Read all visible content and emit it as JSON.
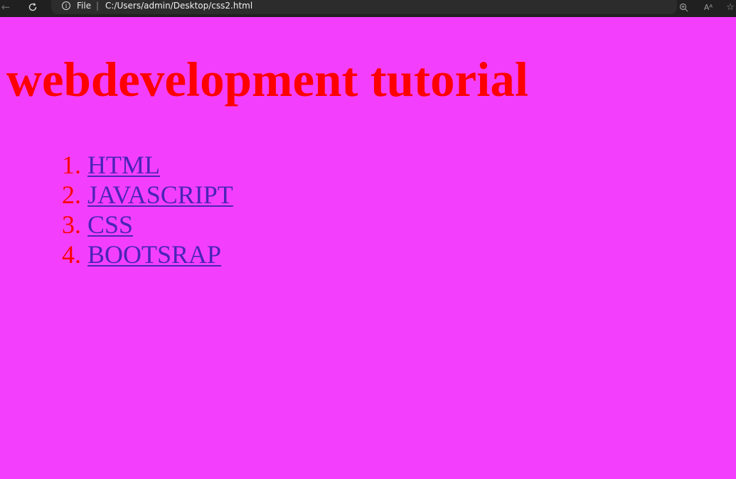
{
  "browser": {
    "back_icon": "arrow-left-icon",
    "reload_icon": "reload-icon",
    "info_icon": "info-icon",
    "scheme_label": "File",
    "separator": "|",
    "url": "C:/Users/admin/Desktop/css2.html",
    "zoom_icon": "zoom-in-icon",
    "read_aloud_label": "Aᴬ",
    "favorite_icon": "star-icon"
  },
  "page": {
    "heading": "webdevelopment tutorial",
    "items": [
      {
        "number": "1.",
        "label": "HTML"
      },
      {
        "number": "2.",
        "label": "JAVASCRIPT"
      },
      {
        "number": "3.",
        "label": "CSS"
      },
      {
        "number": "4.",
        "label": "BOOTSRAP"
      }
    ]
  },
  "colors": {
    "background": "#f33ffd",
    "heading": "#ff0000",
    "list_number": "#ff0000",
    "link": "#4b23b8",
    "toolbar": "#202020"
  }
}
